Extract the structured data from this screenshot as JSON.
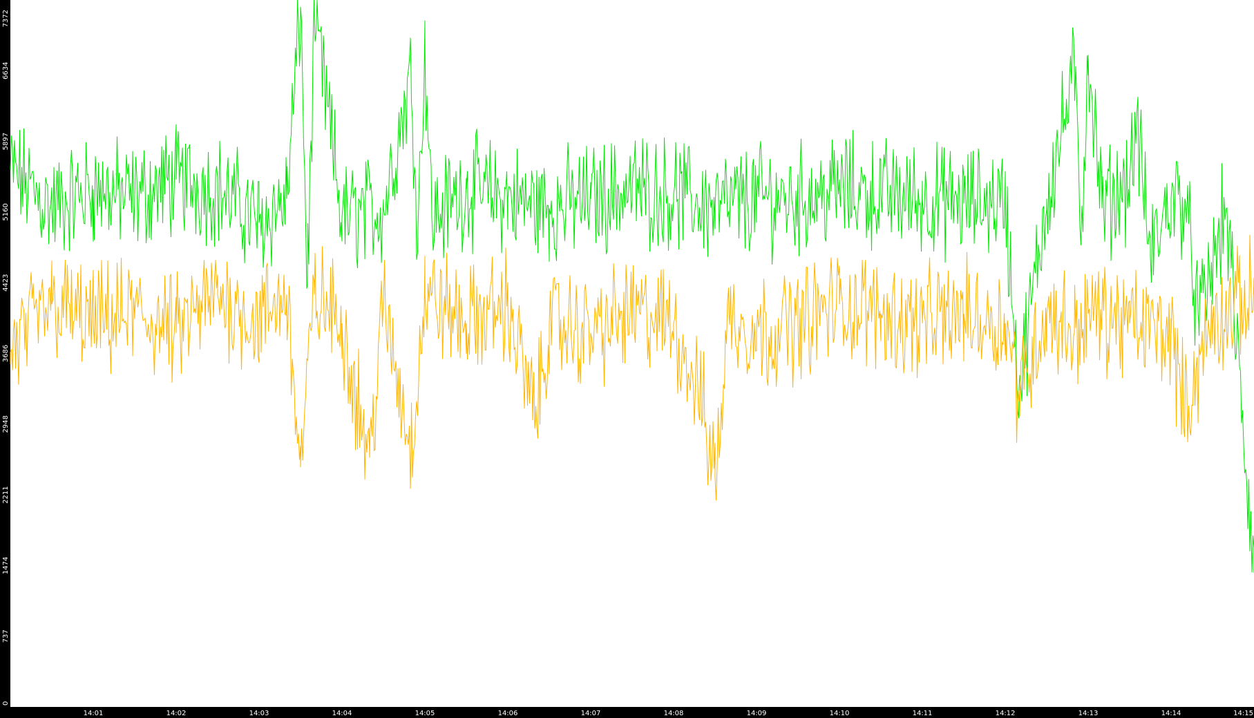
{
  "chart_data": {
    "type": "line",
    "title": "",
    "xlabel": "",
    "ylabel": "",
    "ylim": [
      0,
      7372
    ],
    "xlim": [
      "14:00:00",
      "14:15:00"
    ],
    "yticks": [
      "0",
      "737",
      "1474",
      "2211",
      "2948",
      "3686",
      "4423",
      "5160",
      "5897",
      "6634",
      "7372"
    ],
    "xticks": [
      "14:01",
      "14:02",
      "14:03",
      "14:04",
      "14:05",
      "14:06",
      "14:07",
      "14:08",
      "14:09",
      "14:10",
      "14:11",
      "14:12",
      "14:13",
      "14:14",
      "14:15"
    ],
    "grid": false,
    "legend": "none",
    "background_color": "#ffffff",
    "axis_band_color": "#000000",
    "tick_label_color": "#ffffff",
    "series": [
      {
        "color": "#00e600",
        "x": [
          "14:00:00",
          "14:00:30",
          "14:01:00",
          "14:01:30",
          "14:02:00",
          "14:02:30",
          "14:03:00",
          "14:03:20",
          "14:03:30",
          "14:03:35",
          "14:03:40",
          "14:04:00",
          "14:04:30",
          "14:04:50",
          "14:04:55",
          "14:05:00",
          "14:05:05",
          "14:05:30",
          "14:06:00",
          "14:06:30",
          "14:07:00",
          "14:07:30",
          "14:08:00",
          "14:08:30",
          "14:09:00",
          "14:09:30",
          "14:10:00",
          "14:10:30",
          "14:11:00",
          "14:11:30",
          "14:12:00",
          "14:12:10",
          "14:12:30",
          "14:12:50",
          "14:12:55",
          "14:13:00",
          "14:13:10",
          "14:13:30",
          "14:13:35",
          "14:13:45",
          "14:14:00",
          "14:14:10",
          "14:14:20",
          "14:14:40",
          "14:15:00"
        ],
        "values": [
          5600,
          5200,
          5400,
          5300,
          5500,
          5400,
          5050,
          5300,
          7300,
          4400,
          7200,
          5100,
          5200,
          6600,
          5000,
          6900,
          5100,
          5400,
          5300,
          5200,
          5300,
          5400,
          5350,
          5200,
          5300,
          5300,
          5400,
          5350,
          5300,
          5250,
          5300,
          3300,
          5300,
          6600,
          5000,
          6800,
          5200,
          5500,
          6100,
          4700,
          5300,
          5300,
          4000,
          5200,
          1400
        ]
      },
      {
        "color": "#ffb400",
        "x": [
          "14:00:00",
          "14:00:30",
          "14:01:00",
          "14:01:30",
          "14:02:00",
          "14:02:30",
          "14:03:00",
          "14:03:20",
          "14:03:30",
          "14:03:40",
          "14:04:00",
          "14:04:20",
          "14:04:30",
          "14:04:50",
          "14:05:00",
          "14:05:30",
          "14:06:00",
          "14:06:20",
          "14:06:30",
          "14:07:00",
          "14:07:30",
          "14:08:00",
          "14:08:20",
          "14:08:30",
          "14:08:40",
          "14:09:00",
          "14:09:30",
          "14:10:00",
          "14:10:30",
          "14:11:00",
          "14:11:30",
          "14:12:00",
          "14:12:10",
          "14:12:30",
          "14:12:50",
          "14:13:00",
          "14:13:30",
          "14:14:00",
          "14:14:10",
          "14:14:30",
          "14:15:00"
        ],
        "values": [
          3700,
          4200,
          4000,
          4100,
          3900,
          4300,
          4000,
          4300,
          2500,
          4300,
          4000,
          2600,
          4200,
          2700,
          4300,
          4000,
          4200,
          3000,
          4000,
          3900,
          4100,
          4000,
          3200,
          2400,
          4100,
          3900,
          4000,
          4200,
          4100,
          4000,
          4100,
          4000,
          3300,
          4100,
          3900,
          4100,
          4000,
          3900,
          3100,
          4000,
          4300
        ]
      }
    ]
  }
}
